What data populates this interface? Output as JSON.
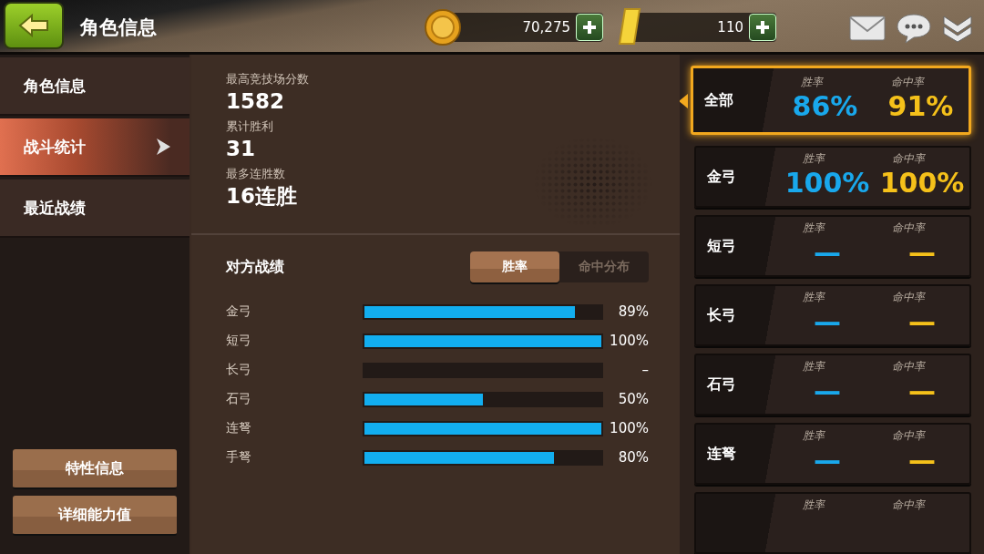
{
  "header": {
    "title": "角色信息",
    "coins": "70,275",
    "gold": "110"
  },
  "sidebar": {
    "items": [
      {
        "label": "角色信息",
        "selected": false
      },
      {
        "label": "战斗统计",
        "selected": true
      },
      {
        "label": "最近战绩",
        "selected": false
      }
    ],
    "buttons": [
      "特性信息",
      "详细能力值"
    ]
  },
  "stats": [
    {
      "label": "最高竞技场分数",
      "value": "1582"
    },
    {
      "label": "累计胜利",
      "value": "31"
    },
    {
      "label": "最多连胜数",
      "value": "16连胜"
    }
  ],
  "opponent": {
    "title": "对方战绩",
    "tabs": [
      {
        "label": "胜率",
        "selected": true
      },
      {
        "label": "命中分布",
        "selected": false
      }
    ],
    "rows": [
      {
        "name": "金弓",
        "level": 0.89,
        "reading": "89%"
      },
      {
        "name": "短弓",
        "level": 1,
        "reading": "100%"
      },
      {
        "name": "长弓",
        "reading": "–"
      },
      {
        "name": "石弓",
        "level": 0.5,
        "reading": "50%"
      },
      {
        "name": "连弩",
        "level": 1,
        "reading": "100%"
      },
      {
        "name": "手弩",
        "level": 0.8,
        "reading": "80%"
      }
    ]
  },
  "weapons": [
    {
      "name": "全部",
      "selected": true,
      "win_label": "胜率",
      "win": "86%",
      "hit_label": "命中率",
      "hit": "91%"
    },
    {
      "name": "金弓",
      "selected": false,
      "win_label": "胜率",
      "win": "100%",
      "hit_label": "命中率",
      "hit": "100%"
    },
    {
      "name": "短弓",
      "selected": false,
      "win_label": "胜率",
      "win": "—",
      "hit_label": "命中率",
      "hit": "—"
    },
    {
      "name": "长弓",
      "selected": false,
      "win_label": "胜率",
      "win": "—",
      "hit_label": "命中率",
      "hit": "—"
    },
    {
      "name": "石弓",
      "selected": false,
      "win_label": "胜率",
      "win": "—",
      "hit_label": "命中率",
      "hit": "—"
    },
    {
      "name": "连弩",
      "selected": false,
      "win_label": "胜率",
      "win": "—",
      "hit_label": "命中率",
      "hit": "—"
    },
    {
      "selected": false,
      "win_label": "胜率",
      "hit_label": "命中率"
    }
  ]
}
